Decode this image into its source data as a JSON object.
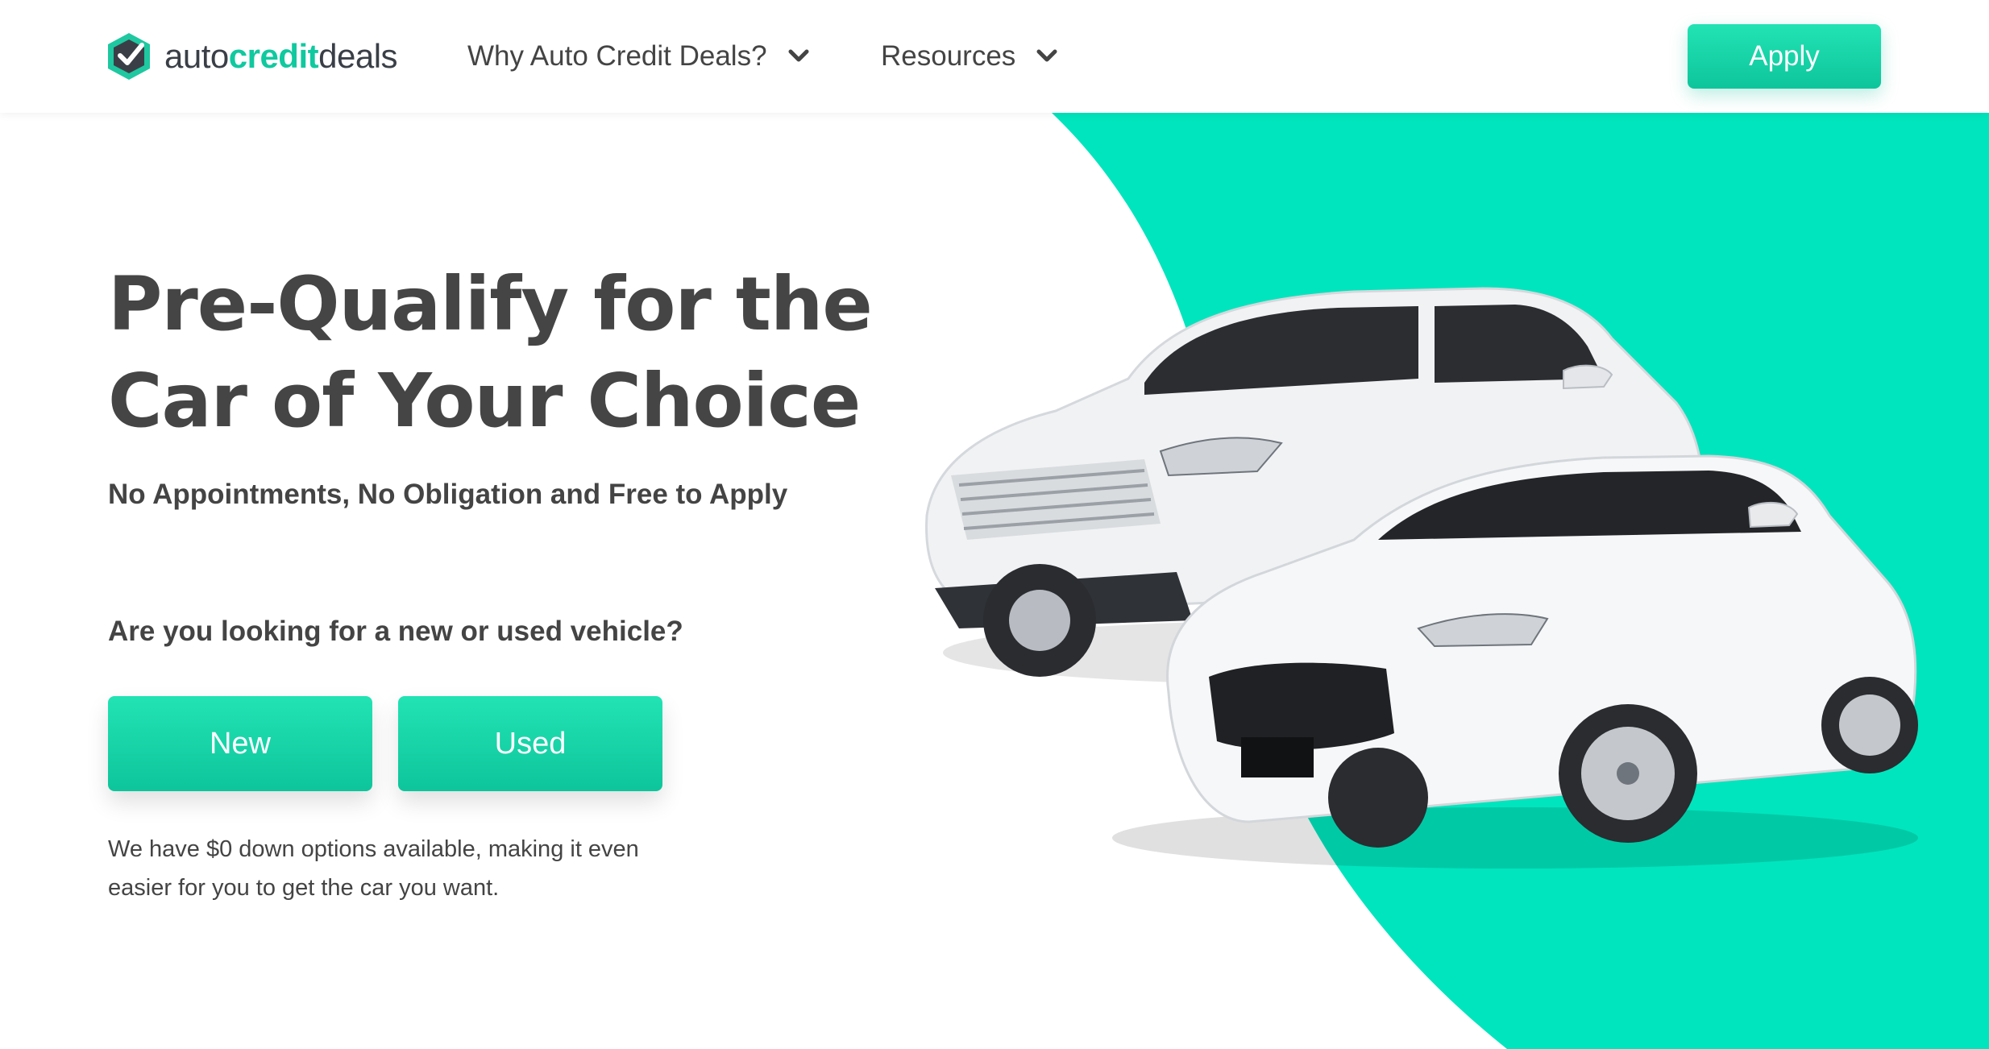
{
  "brand": {
    "logo_parts": [
      "auto",
      "credit",
      "deals"
    ],
    "accent_color": "#10c99f",
    "dark_color": "#3a3f47"
  },
  "nav": {
    "items": [
      {
        "label": "Why Auto Credit Deals?",
        "icon": "chevron-down-icon"
      },
      {
        "label": "Resources",
        "icon": "chevron-down-icon"
      }
    ],
    "apply_label": "Apply"
  },
  "hero": {
    "title": "Pre-Qualify for the Car of Your Choice",
    "subtitle": "No Appointments, No Obligation and Free to Apply",
    "question": "Are you looking for a new or used vehicle?",
    "options": [
      "New",
      "Used"
    ],
    "note": "We have $0 down options available, making it even easier for you to get the car you want.",
    "background_color": "#00e5bd"
  }
}
